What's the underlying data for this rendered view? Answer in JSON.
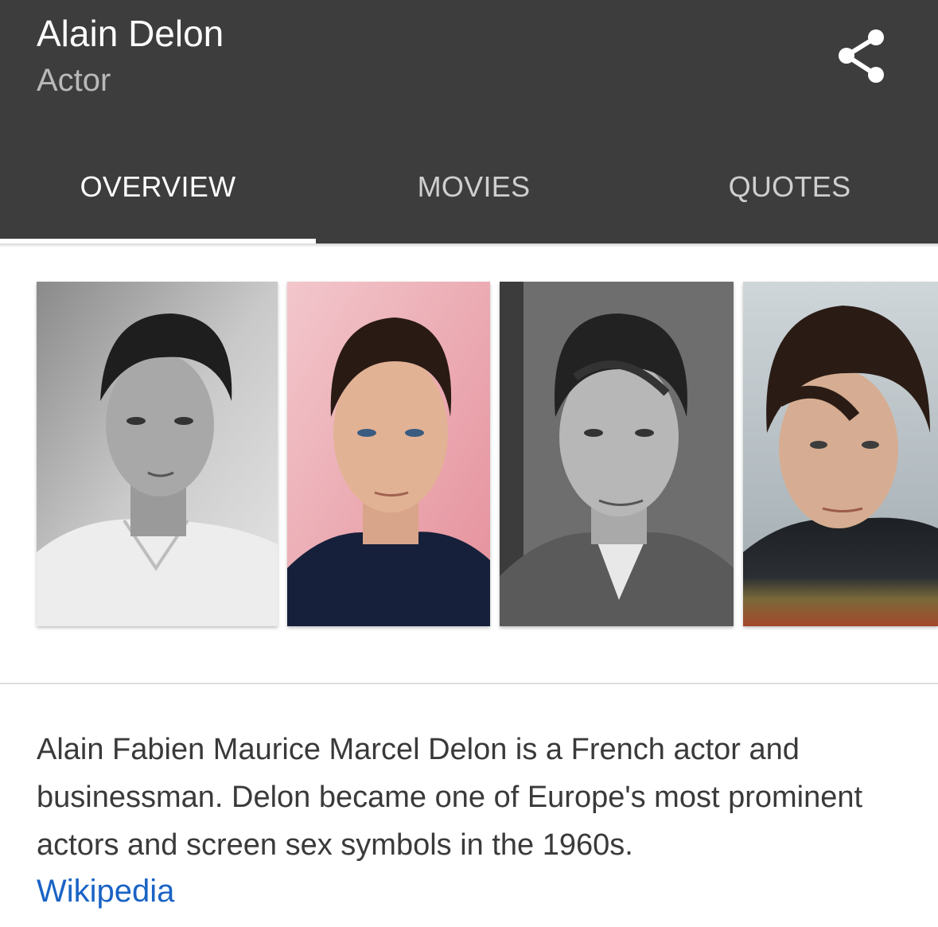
{
  "header": {
    "title": "Alain Delon",
    "subtitle": "Actor",
    "share_icon": "share-icon"
  },
  "tabs": [
    {
      "label": "OVERVIEW",
      "active": true
    },
    {
      "label": "MOVIES",
      "active": false
    },
    {
      "label": "QUOTES",
      "active": false
    }
  ],
  "photos": [
    {
      "style": "black-and-white"
    },
    {
      "style": "color"
    },
    {
      "style": "black-and-white"
    },
    {
      "style": "color"
    }
  ],
  "description": {
    "text": "Alain Fabien Maurice Marcel Delon is a French actor and businessman. Delon became one of Europe's most prominent actors and screen sex symbols in the 1960s.",
    "source_link": "Wikipedia"
  },
  "colors": {
    "header_bg": "#3d3d3d",
    "link": "#1a63c5"
  }
}
